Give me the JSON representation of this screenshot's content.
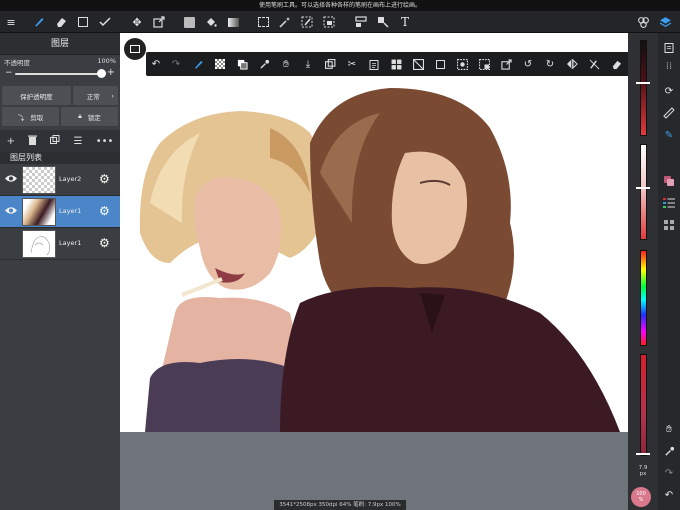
{
  "status_bar": {
    "text": "使用笔刷工具。可以选择各种各样的笔刷在画布上进行绘画。"
  },
  "toolbar": {
    "icons": [
      "menu-icon",
      "brush-icon",
      "eraser-icon",
      "rectangle-icon",
      "smudge-icon",
      "move-icon",
      "transform-icon",
      "fill-rect-icon",
      "bucket-icon",
      "gradient-icon",
      "select-rect-icon",
      "magic-wand-icon",
      "select-pen-icon",
      "select-eraser-icon",
      "layer-move-icon",
      "crop-icon",
      "text-icon",
      "material-icon",
      "layers-icon"
    ],
    "text_tool_label": "T"
  },
  "layers_panel": {
    "title": "图层",
    "opacity_label": "不透明度",
    "opacity_value": "100%",
    "opacity_fraction": 1.0,
    "protect_alpha_label": "保护透明度",
    "blend_mode": "正常",
    "clip_label": "剪取",
    "lock_label": "锁定",
    "list_title": "图层列表",
    "layers": [
      {
        "name": "Layer2",
        "visible": true,
        "selected": false
      },
      {
        "name": "Layer1",
        "visible": true,
        "selected": true
      },
      {
        "name": "Layer1",
        "visible": false,
        "selected": false
      }
    ]
  },
  "canvas": {
    "info": "3541*2508px 350dpi 64% 笔刷: 7.9px 100%"
  },
  "right_panel": {
    "brush_size": "7.9",
    "brush_size_unit": "px",
    "zoom": "100",
    "zoom_unit": "%"
  },
  "colors": {
    "accent": "#3b9cf0",
    "selected_layer": "#4a86c8",
    "panel": "#3a3d41",
    "zoom_badge": "#d9788d"
  }
}
